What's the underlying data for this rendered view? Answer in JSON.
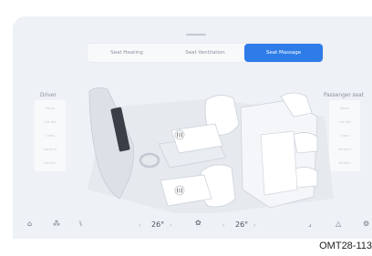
{
  "tabs": [
    {
      "label": "Seat Heating",
      "active": false
    },
    {
      "label": "Seat Ventilation",
      "active": false
    },
    {
      "label": "Seat Massage",
      "active": true
    }
  ],
  "driver": {
    "label": "Driver",
    "options": [
      "Wave",
      "Cat-like",
      "Cross",
      "Serpent",
      "Stretch"
    ]
  },
  "passenger": {
    "label": "Passenger seat",
    "options": [
      "Wave",
      "Cat-like",
      "Cross",
      "Serpent",
      "Stretch"
    ]
  },
  "climate": {
    "driver_temp": "26°",
    "passenger_temp": "26°"
  },
  "bottom_icons": [
    "home-icon",
    "apps-icon",
    "seat-icon",
    "fan-icon",
    "seat-recline-icon",
    "alert-triangle-icon",
    "settings-icon"
  ],
  "colors": {
    "accent": "#2d7ce8",
    "background": "#eef1f6"
  },
  "caption": "OMT28-113"
}
